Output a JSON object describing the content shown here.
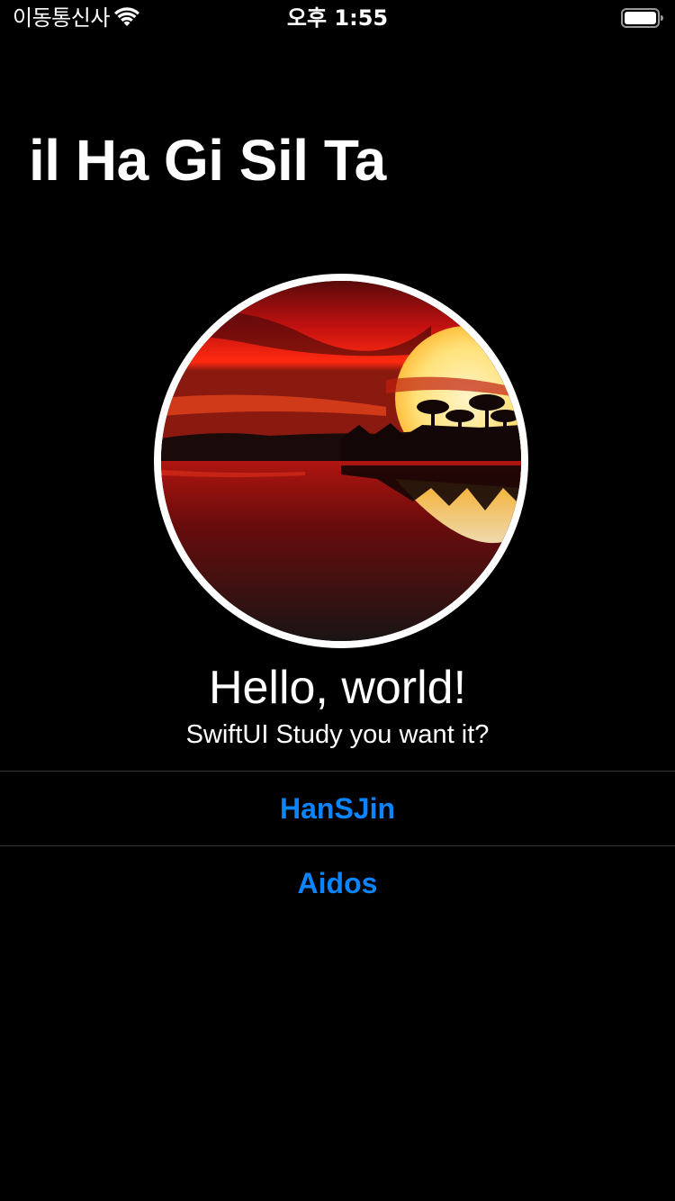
{
  "status_bar": {
    "carrier": "이동통신사",
    "time": "오후 1:55",
    "wifi_icon": "wifi-icon",
    "battery_icon": "battery-icon"
  },
  "nav": {
    "title": "il Ha Gi Sil Ta"
  },
  "profile": {
    "image_icon": "sunset-photo",
    "headline": "Hello, world!",
    "subheadline": "SwiftUI Study you want it?"
  },
  "list": {
    "items": [
      {
        "label": "HanSJin"
      },
      {
        "label": "Aidos"
      }
    ]
  },
  "colors": {
    "background": "#000000",
    "text": "#ffffff",
    "link": "#0a84ff",
    "divider": "#38383a"
  }
}
